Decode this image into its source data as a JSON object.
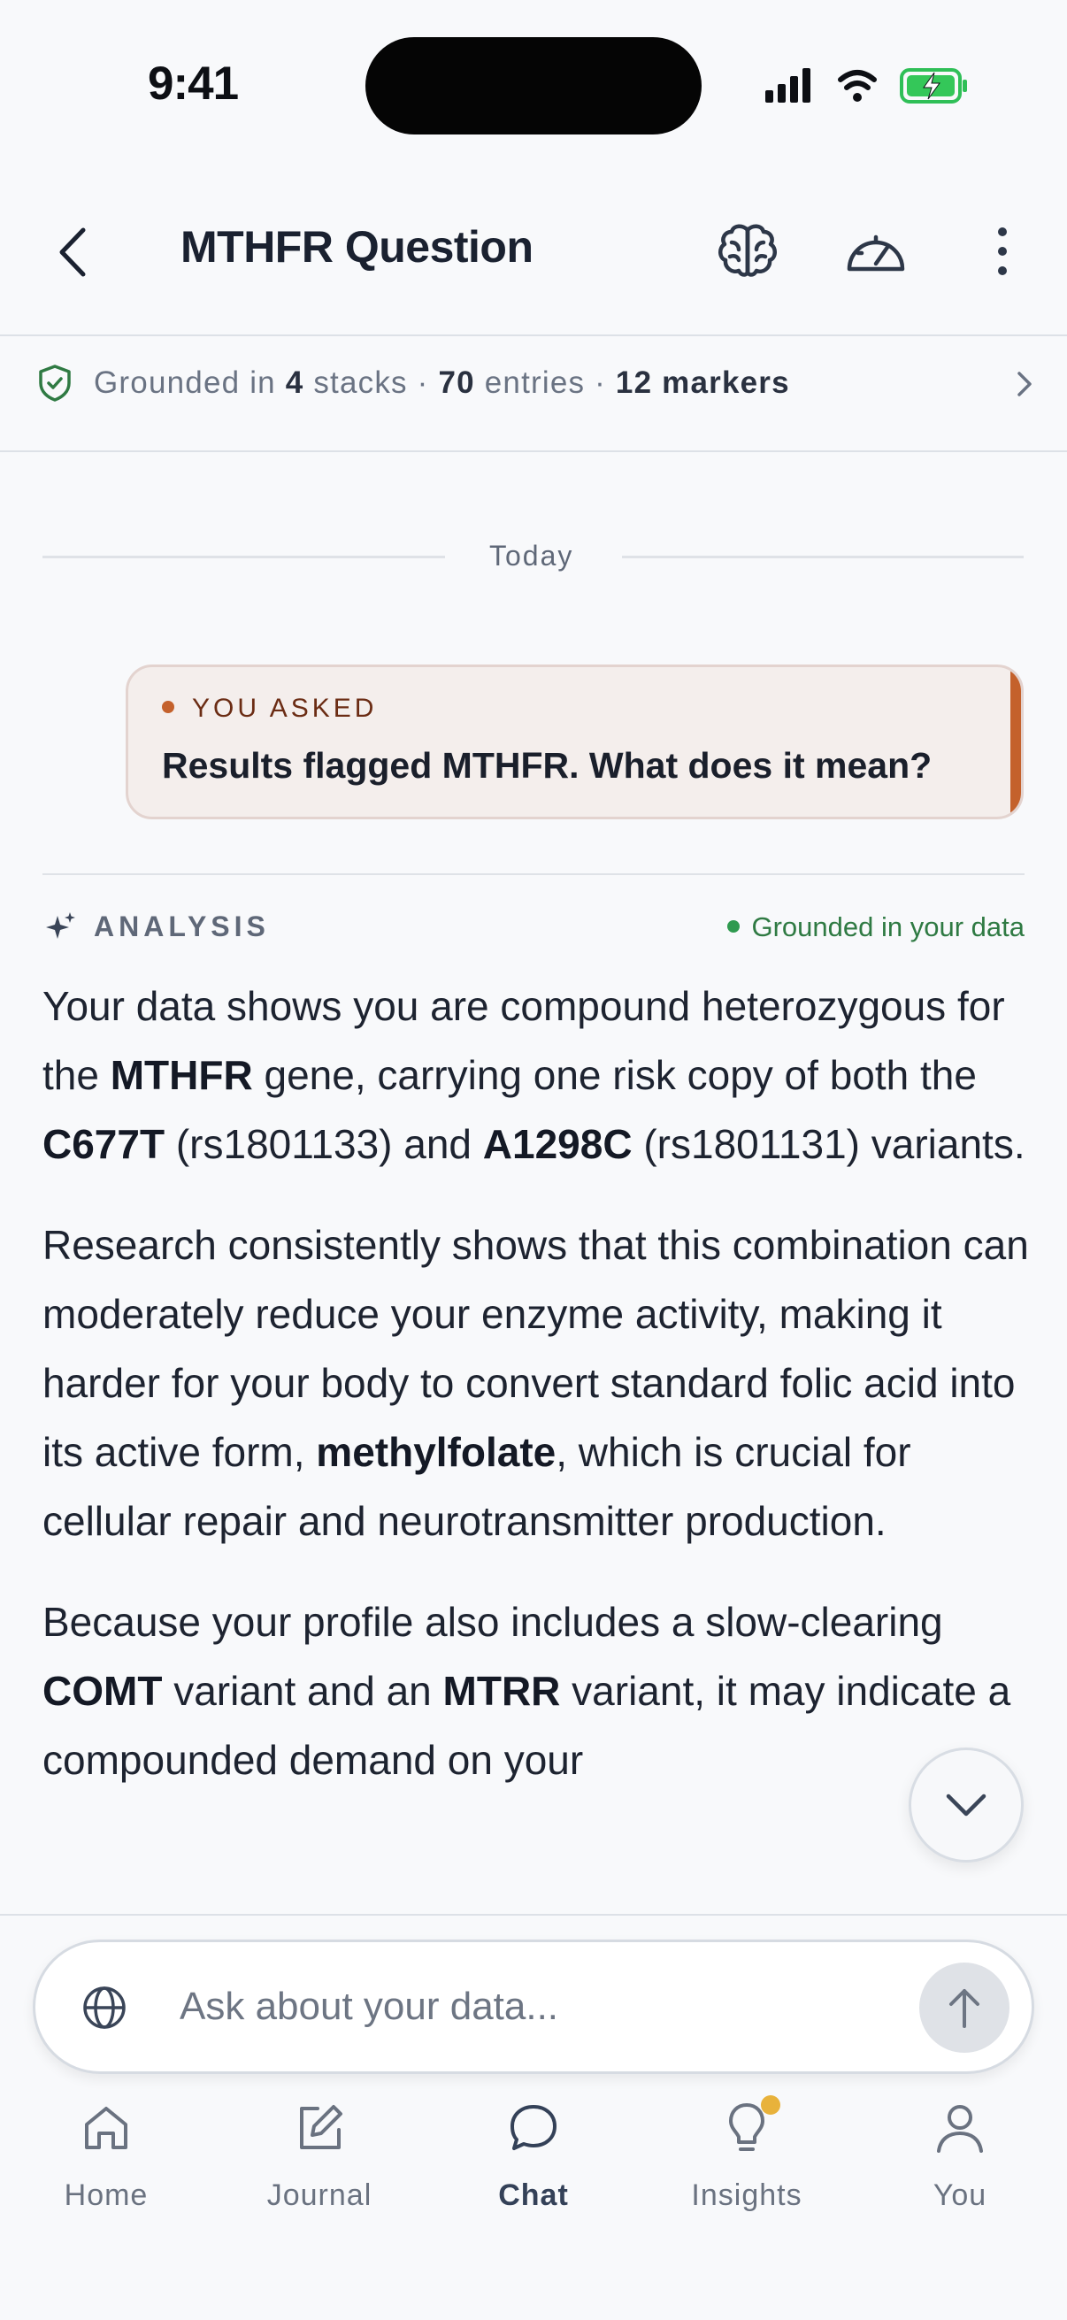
{
  "status": {
    "time": "9:41"
  },
  "header": {
    "title": "MTHFR Question"
  },
  "grounding": {
    "prefix": "Grounded in ",
    "stacks_count": "4",
    "stacks_label": " stacks · ",
    "entries_count": "70",
    "entries_label": " entries · ",
    "markers": "12 markers"
  },
  "divider_label": "Today",
  "asked": {
    "label": "YOU ASKED",
    "question": "Results flagged MTHFR.  What does it mean?"
  },
  "analysis": {
    "label": "ANALYSIS",
    "grounded": "Grounded in your data",
    "p1": [
      "Your data shows you are compound heterozygous for the ",
      "MTHFR",
      " gene, carrying one risk copy of both the ",
      "C677T",
      " (rs1801133) and ",
      "A1298C",
      " (rs1801131) variants."
    ],
    "p2": [
      "Research consistently shows that this combination can moderately reduce your enzyme activity, making it harder for your body to convert standard folic acid into its active form, ",
      "methylfolate",
      ", which is crucial for cellular repair and neurotransmitter production."
    ],
    "p3": [
      "Because your profile also includes a slow-clearing ",
      "COMT",
      " variant and an ",
      "MTRR",
      " variant, it may indicate a compounded demand on your"
    ]
  },
  "compose": {
    "placeholder": "Ask about your data..."
  },
  "tabs": [
    {
      "label": "Home",
      "icon": "home-icon"
    },
    {
      "label": "Journal",
      "icon": "pencil-icon"
    },
    {
      "label": "Chat",
      "icon": "chat-bubble-icon",
      "active": true
    },
    {
      "label": "Insights",
      "icon": "lightbulb-icon",
      "badge": true
    },
    {
      "label": "You",
      "icon": "user-icon"
    }
  ],
  "colors": {
    "accent": "#c4612c",
    "grounded_green": "#2f7a43",
    "badge": "#e8b23b",
    "background": "#f8f9fb"
  }
}
